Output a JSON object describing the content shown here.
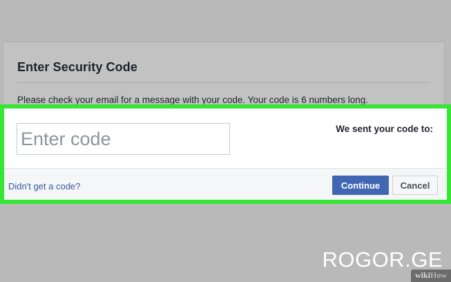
{
  "dialog": {
    "title": "Enter Security Code",
    "description": "Please check your email for a message with your code. Your code is 6 numbers long.",
    "code_input": {
      "placeholder": "Enter code",
      "value": ""
    },
    "sent_label": "We sent your code to:",
    "resend_link": "Didn't get a code?",
    "continue_label": "Continue",
    "cancel_label": "Cancel"
  },
  "overlay": {
    "watermark": "ROGOR.GE",
    "badge_wiki": "wiki",
    "badge_how": "How"
  },
  "colors": {
    "highlight": "#36e635",
    "primary_button": "#4267b2",
    "link": "#365899",
    "backdrop": "#b9b9b9"
  }
}
